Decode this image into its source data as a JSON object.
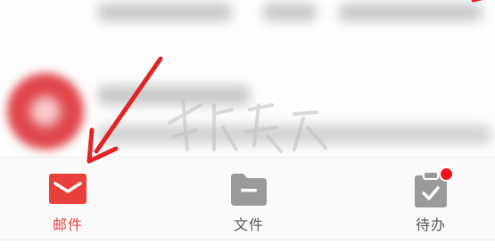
{
  "tabs": [
    {
      "label": "邮件",
      "icon": "mail-icon",
      "active": true
    },
    {
      "label": "文件",
      "icon": "folder-icon",
      "active": false
    },
    {
      "label": "待办",
      "icon": "clipboard-check-icon",
      "active": false,
      "has_badge": true
    }
  ],
  "colors": {
    "accent": "#e8413c",
    "icon_inactive": "#9a9a9a",
    "badge": "#f0151e",
    "annotation_arrow": "#e02424"
  }
}
